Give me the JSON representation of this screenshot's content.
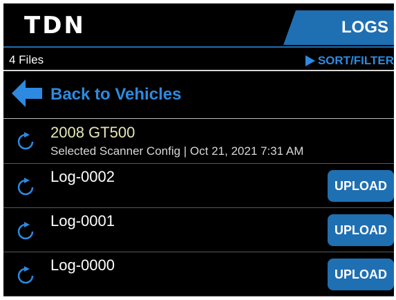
{
  "header": {
    "logo_text": "TDN",
    "tab_label": "LOGS"
  },
  "status": {
    "file_count": "4 Files",
    "sort_filter_label": "SORT/FILTER"
  },
  "back": {
    "label": "Back to Vehicles"
  },
  "vehicle": {
    "name": "2008 GT500",
    "subtitle": "Selected Scanner Config  |  Oct 21, 2021 7:31 AM"
  },
  "logs": [
    {
      "name": "Log-0002",
      "action": "UPLOAD"
    },
    {
      "name": "Log-0001",
      "action": "UPLOAD"
    },
    {
      "name": "Log-0000",
      "action": "UPLOAD"
    }
  ],
  "colors": {
    "accent": "#1f6fb3",
    "link": "#2e8ae0",
    "vehicle_text": "#e6e8b5"
  }
}
